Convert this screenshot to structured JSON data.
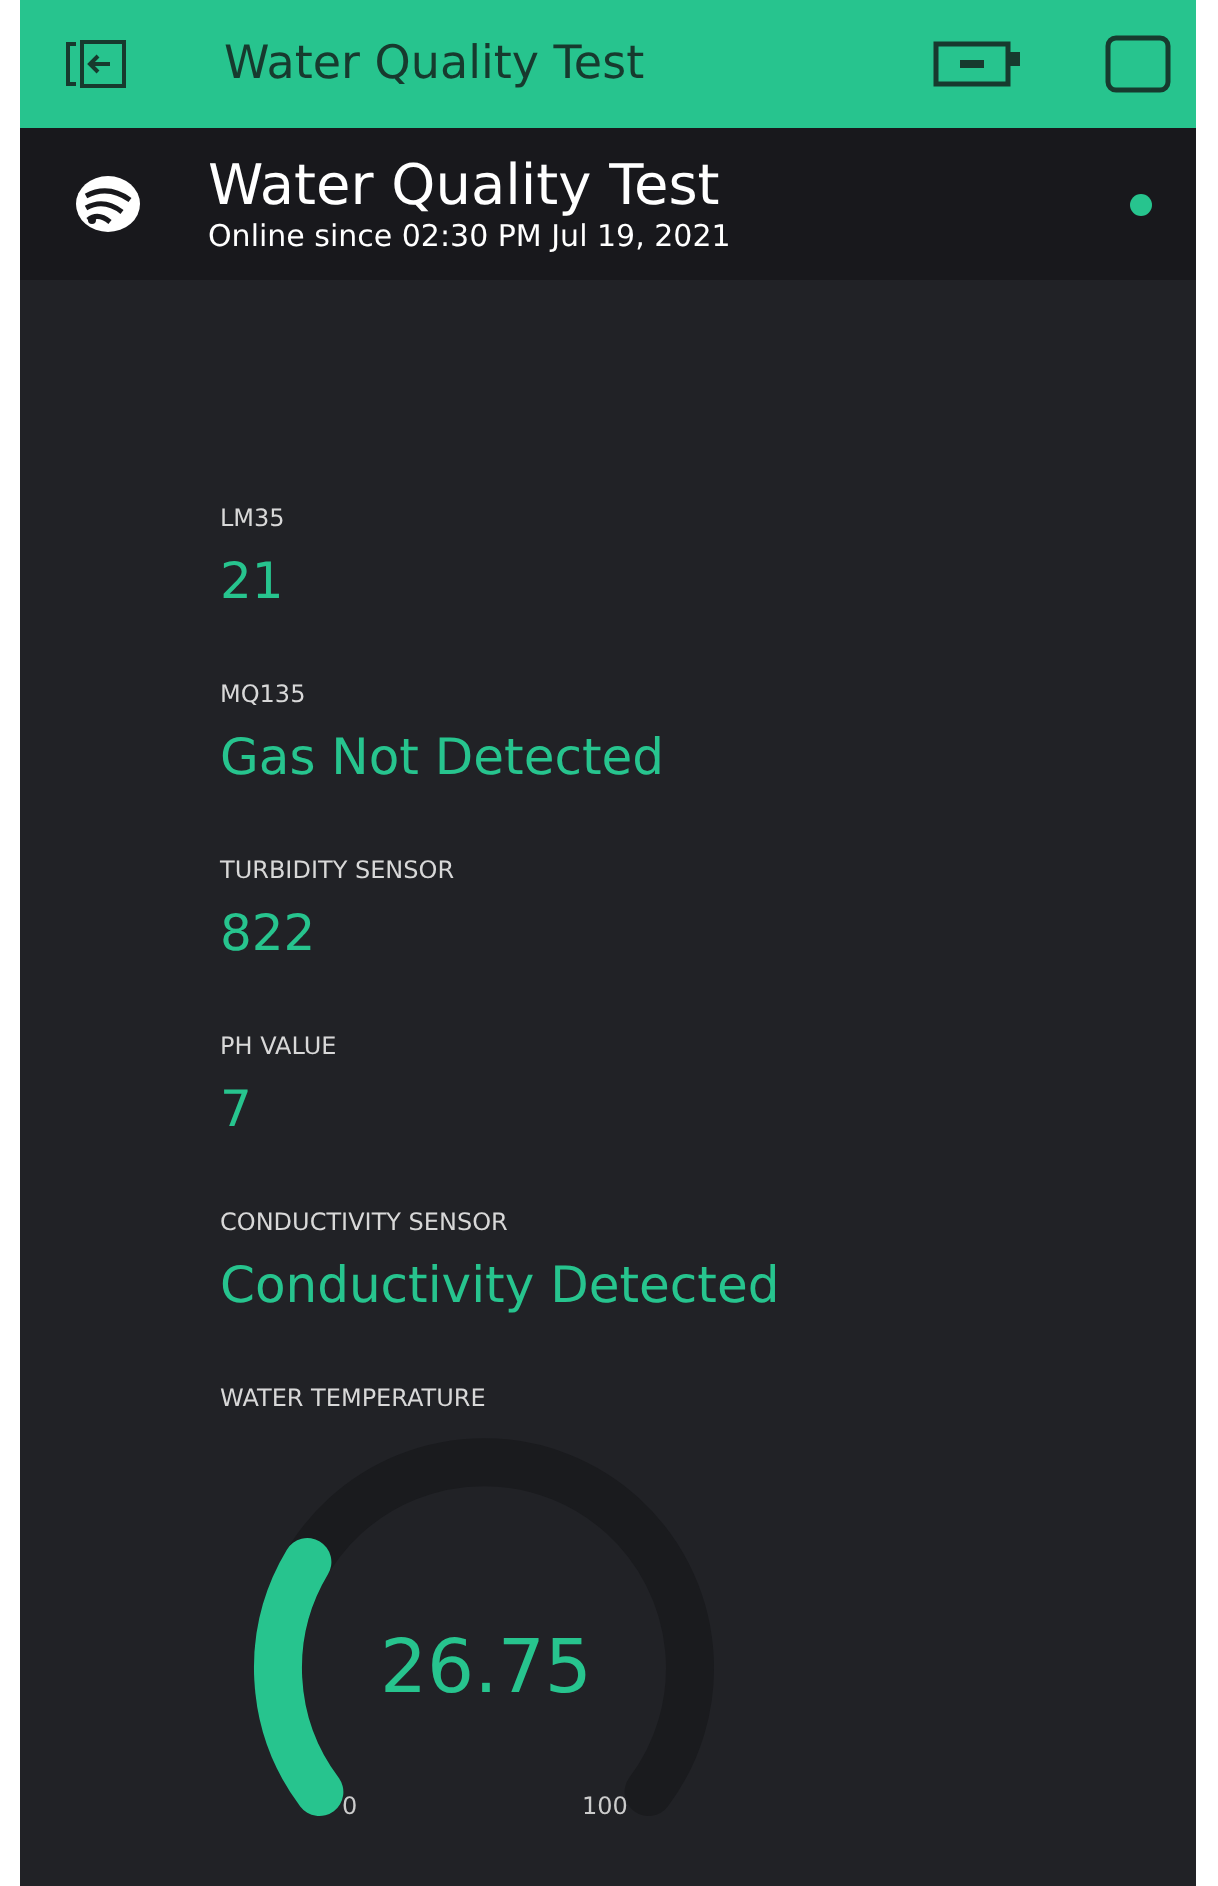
{
  "app_bar": {
    "title": "Water Quality Test"
  },
  "device": {
    "name": "Water Quality Test",
    "status": "Online since 02:30 PM Jul 19, 2021",
    "online": true
  },
  "widgets": [
    {
      "kind": "value",
      "label": "LM35",
      "value": "21"
    },
    {
      "kind": "value",
      "label": "MQ135",
      "value": "Gas Not Detected"
    },
    {
      "kind": "value",
      "label": "TURBIDITY SENSOR",
      "value": "822"
    },
    {
      "kind": "value",
      "label": "PH VALUE",
      "value": "7"
    },
    {
      "kind": "value",
      "label": "CONDUCTIVITY SENSOR",
      "value": "Conductivity Detected"
    },
    {
      "kind": "gauge",
      "label": "WATER TEMPERATURE",
      "value": "26.75",
      "min": "0",
      "max": "100"
    }
  ]
}
